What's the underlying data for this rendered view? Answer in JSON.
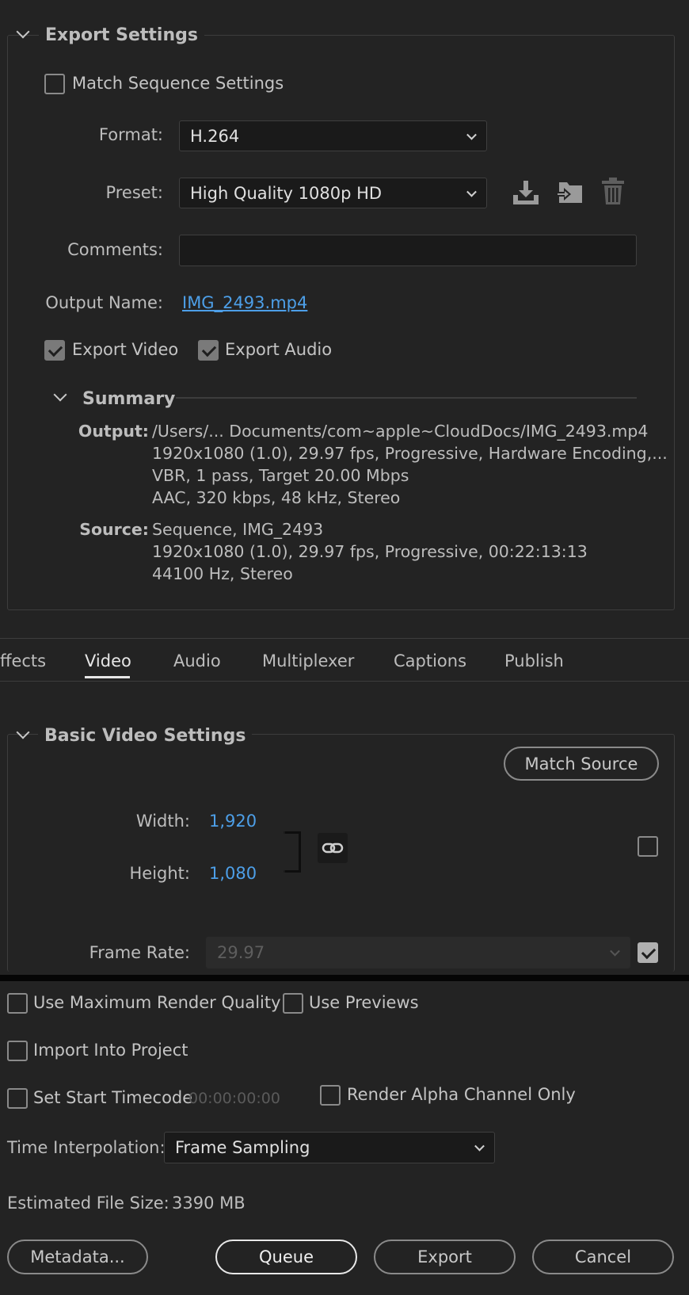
{
  "export_settings": {
    "title": "Export Settings",
    "match_sequence_label": "Match Sequence Settings",
    "match_sequence_checked": false,
    "format_label": "Format:",
    "format_value": "H.264",
    "preset_label": "Preset:",
    "preset_value": "High Quality 1080p HD",
    "preset_icons": [
      "save-preset-icon",
      "import-preset-icon",
      "delete-preset-icon"
    ],
    "comments_label": "Comments:",
    "comments_value": "",
    "output_name_label": "Output Name:",
    "output_name_value": "IMG_2493.mp4",
    "export_video_label": "Export Video",
    "export_video_checked": true,
    "export_audio_label": "Export Audio",
    "export_audio_checked": true
  },
  "summary": {
    "title": "Summary",
    "output_label": "Output:",
    "output_lines": [
      "/Users/... Documents/com~apple~CloudDocs/IMG_2493.mp4",
      "1920x1080 (1.0), 29.97 fps, Progressive, Hardware Encoding,...",
      "VBR, 1 pass, Target 20.00 Mbps",
      "AAC, 320 kbps, 48 kHz, Stereo"
    ],
    "source_label": "Source:",
    "source_lines": [
      "Sequence, IMG_2493",
      "1920x1080 (1.0), 29.97 fps, Progressive, 00:22:13:13",
      "44100 Hz, Stereo"
    ]
  },
  "tabs": {
    "items": [
      "ffects",
      "Video",
      "Audio",
      "Multiplexer",
      "Captions",
      "Publish"
    ],
    "active": "Video"
  },
  "video": {
    "section_title": "Basic Video Settings",
    "match_source_label": "Match Source",
    "width_label": "Width:",
    "width_value": "1,920",
    "height_label": "Height:",
    "height_value": "1,080",
    "link_icon": "chain-link-icon",
    "resize_checked": false,
    "frame_rate_label": "Frame Rate:",
    "frame_rate_value": "29.97",
    "frame_rate_checked": true
  },
  "bottom": {
    "max_render_label": "Use Maximum Render Quality",
    "max_render_checked": false,
    "use_previews_label": "Use Previews",
    "use_previews_checked": false,
    "import_project_label": "Import Into Project",
    "import_project_checked": false,
    "start_timecode_label": "Set Start Timecode",
    "start_timecode_checked": false,
    "start_timecode_value": "00:00:00:00",
    "alpha_label": "Render Alpha Channel Only",
    "alpha_checked": false,
    "time_interp_label": "Time Interpolation:",
    "time_interp_value": "Frame Sampling",
    "file_size_label": "Estimated File Size:",
    "file_size_value": "3390 MB"
  },
  "buttons": {
    "metadata": "Metadata...",
    "queue": "Queue",
    "export": "Export",
    "cancel": "Cancel"
  }
}
